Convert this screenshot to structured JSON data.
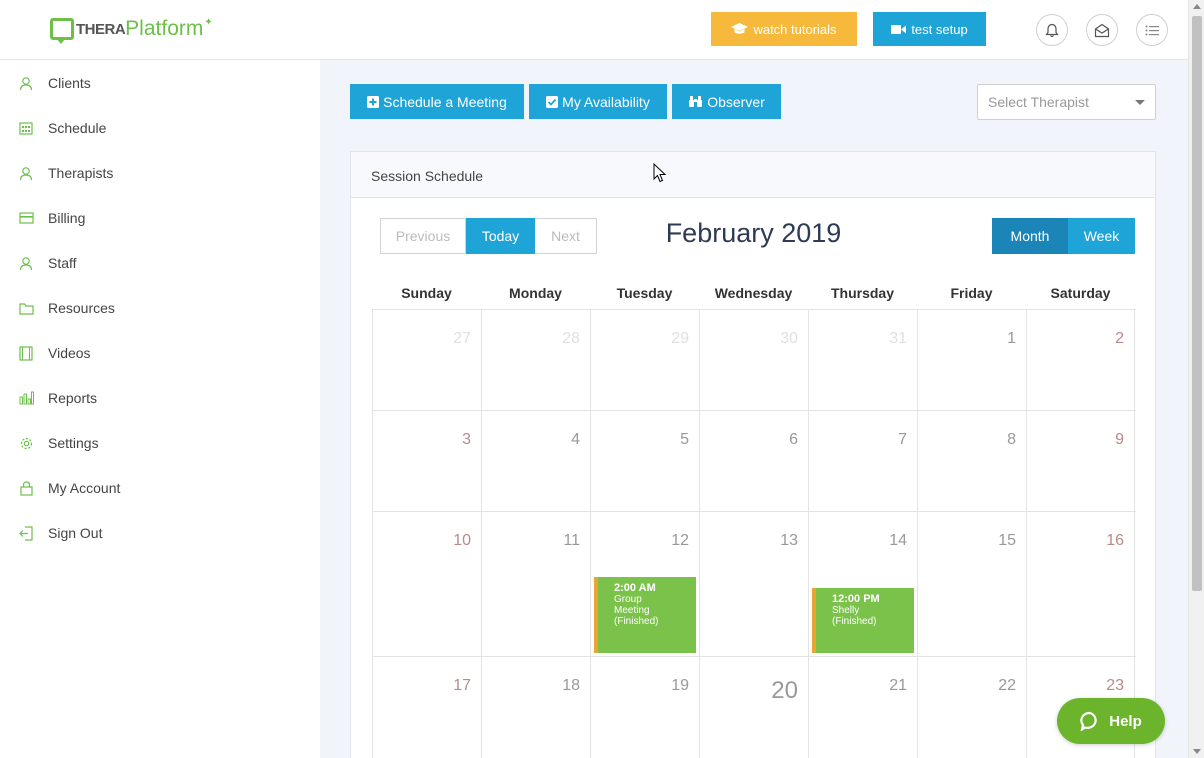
{
  "header": {
    "logo_thera": "THERA",
    "logo_platform": "Platform",
    "watch_tutorials": "watch tutorials",
    "test_setup": "test setup"
  },
  "sidebar": {
    "items": [
      {
        "label": "Clients",
        "icon": "users-icon"
      },
      {
        "label": "Schedule",
        "icon": "calendar-icon"
      },
      {
        "label": "Therapists",
        "icon": "users-icon"
      },
      {
        "label": "Billing",
        "icon": "credit-card-icon"
      },
      {
        "label": "Staff",
        "icon": "users-icon"
      },
      {
        "label": "Resources",
        "icon": "folder-icon"
      },
      {
        "label": "Videos",
        "icon": "film-icon"
      },
      {
        "label": "Reports",
        "icon": "bar-chart-icon"
      },
      {
        "label": "Settings",
        "icon": "gear-icon"
      },
      {
        "label": "My Account",
        "icon": "lock-icon"
      },
      {
        "label": "Sign Out",
        "icon": "sign-out-icon"
      }
    ]
  },
  "actions": {
    "schedule_meeting": "Schedule a Meeting",
    "my_availability": "My Availability",
    "observer": "Observer",
    "select_therapist_placeholder": "Select Therapist"
  },
  "panel": {
    "title": "Session Schedule"
  },
  "calendar": {
    "previous": "Previous",
    "today": "Today",
    "next": "Next",
    "month_title": "February 2019",
    "view_month": "Month",
    "view_week": "Week",
    "days_of_week": [
      "Sunday",
      "Monday",
      "Tuesday",
      "Wednesday",
      "Thursday",
      "Friday",
      "Saturday"
    ],
    "weeks": [
      [
        "27",
        "28",
        "29",
        "30",
        "31",
        "1",
        "2"
      ],
      [
        "3",
        "4",
        "5",
        "6",
        "7",
        "8",
        "9"
      ],
      [
        "10",
        "11",
        "12",
        "13",
        "14",
        "15",
        "16"
      ],
      [
        "17",
        "18",
        "19",
        "20",
        "21",
        "22",
        "23"
      ]
    ],
    "events": [
      {
        "time": "2:00 AM",
        "line1": "Group",
        "line2": "Meeting",
        "status": "(Finished)"
      },
      {
        "time": "12:00 PM",
        "line1": "Shelly",
        "status": "(Finished)"
      }
    ]
  },
  "help": {
    "label": "Help"
  },
  "colors": {
    "primary_blue": "#1fa4d8",
    "dark_blue": "#1b85b8",
    "tutorial_yellow": "#f6b93b",
    "event_green": "#7bc24a",
    "event_border": "#e8a534",
    "brand_green": "#6cc04a"
  }
}
